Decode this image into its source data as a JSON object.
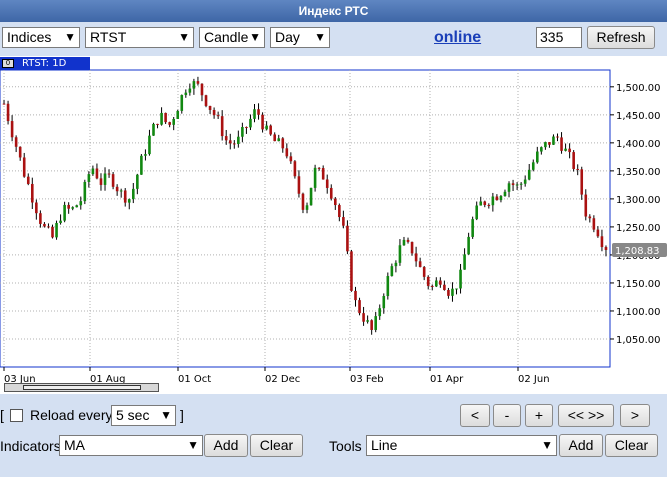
{
  "window": {
    "title": "Индекс РТС"
  },
  "toolbar": {
    "market_select": "Indices",
    "ticker_select": "RTST",
    "chart_type_select": "Candle",
    "period_select": "Day",
    "online_link": "online",
    "count_value": "335",
    "refresh_label": "Refresh"
  },
  "chart": {
    "series_label": "RTST: 1D",
    "last_price_label": "1,208.83"
  },
  "chart_data": {
    "type": "candlestick",
    "series_name": "RTST: 1D",
    "x_tick_labels": [
      "03 Jun",
      "01 Aug",
      "01 Oct",
      "02 Dec",
      "03 Feb",
      "01 Apr",
      "02 Jun"
    ],
    "y_tick_labels": [
      "1,050.00",
      "1,100.00",
      "1,150.00",
      "1,200.00",
      "1,250.00",
      "1,300.00",
      "1,350.00",
      "1,400.00",
      "1,450.00",
      "1,500.00"
    ],
    "ylim": [
      1000,
      1530
    ],
    "last_value": 1208.83,
    "close_path": [
      1470,
      1410,
      1350,
      1300,
      1250,
      1230,
      1280,
      1280,
      1300,
      1360,
      1330,
      1340,
      1310,
      1300,
      1360,
      1410,
      1450,
      1430,
      1470,
      1510,
      1500,
      1470,
      1440,
      1400,
      1400,
      1430,
      1460,
      1420,
      1400,
      1390,
      1330,
      1280,
      1350,
      1340,
      1300,
      1240,
      1120,
      1090,
      1060,
      1130,
      1180,
      1220,
      1210,
      1170,
      1140,
      1160,
      1130,
      1160,
      1250,
      1290,
      1300,
      1310,
      1330,
      1320,
      1350,
      1380,
      1400,
      1410,
      1380,
      1350,
      1270,
      1250,
      1208.83
    ],
    "up_color": "#118811",
    "down_color": "#aa1111"
  },
  "controls": {
    "reload_label": "Reload every",
    "reload_interval": "5 sec",
    "bracket_open": "[",
    "bracket_close": "]",
    "nav_prev": "<",
    "nav_minus": "-",
    "nav_plus": "+",
    "nav_expand": "<< >>",
    "nav_next": ">"
  },
  "indicators": {
    "label": "Indicators",
    "value": "MA",
    "add_label": "Add",
    "clear_label": "Clear"
  },
  "tools": {
    "label": "Tools",
    "value": "Line",
    "add_label": "Add",
    "clear_label": "Clear"
  }
}
